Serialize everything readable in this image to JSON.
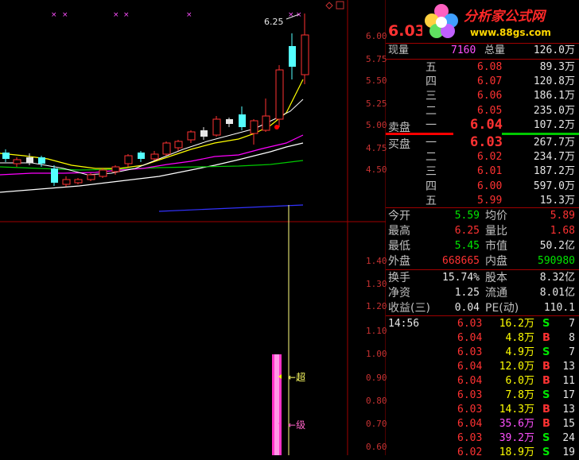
{
  "chart": {
    "price_axis": [
      "6.00",
      "5.75",
      "5.50",
      "5.25",
      "5.00",
      "4.75",
      "4.50"
    ],
    "indicator_axis": [
      "1.40",
      "1.30",
      "1.20",
      "1.10",
      "1.00",
      "0.90",
      "0.80",
      "0.70",
      "0.60"
    ],
    "high_marker": "6.25",
    "annot_chao": "超",
    "annot_ji": "级"
  },
  "quote": {
    "last_price": "6.03",
    "logo_title": "分析家公式网",
    "logo_url": "www.88gs.com",
    "now_vol_label": "现量",
    "now_vol": "7160",
    "total_vol_label": "总量",
    "total_vol": "126.0万",
    "sell_label": "卖盘",
    "buy_label": "买盘",
    "asks": [
      {
        "level": "五",
        "price": "6.08",
        "vol": "89.3万"
      },
      {
        "level": "四",
        "price": "6.07",
        "vol": "120.8万"
      },
      {
        "level": "三",
        "price": "6.06",
        "vol": "186.1万"
      },
      {
        "level": "二",
        "price": "6.05",
        "vol": "235.0万"
      },
      {
        "level": "一",
        "price": "6.04",
        "vol": "107.2万"
      }
    ],
    "bids": [
      {
        "level": "一",
        "price": "6.03",
        "vol": "267.7万"
      },
      {
        "level": "二",
        "price": "6.02",
        "vol": "234.7万"
      },
      {
        "level": "三",
        "price": "6.01",
        "vol": "187.2万"
      },
      {
        "level": "四",
        "price": "6.00",
        "vol": "597.0万"
      },
      {
        "level": "五",
        "price": "5.99",
        "vol": "15.3万"
      }
    ],
    "stats": {
      "open_label": "今开",
      "open": "5.59",
      "avg_label": "均价",
      "avg": "5.89",
      "high_label": "最高",
      "high": "6.25",
      "ratio_label": "量比",
      "ratio": "1.68",
      "low_label": "最低",
      "low": "5.45",
      "mcap_label": "市值",
      "mcap": "50.2亿",
      "outer_label": "外盘",
      "outer": "668665",
      "inner_label": "内盘",
      "inner": "590980",
      "turnover_label": "换手",
      "turnover": "15.74%",
      "capital_label": "股本",
      "capital": "8.32亿",
      "nav_label": "净资",
      "nav": "1.25",
      "float_label": "流通",
      "float": "8.01亿",
      "eps_label": "收益(三)",
      "eps": "0.04",
      "pe_label": "PE(动)",
      "pe": "110.1"
    },
    "ticks": [
      {
        "time": "14:56",
        "price": "6.03",
        "vol": "16.2万",
        "side": "S",
        "n": "7"
      },
      {
        "time": "",
        "price": "6.04",
        "vol": "4.8万",
        "side": "B",
        "n": "8"
      },
      {
        "time": "",
        "price": "6.03",
        "vol": "4.9万",
        "side": "S",
        "n": "7"
      },
      {
        "time": "",
        "price": "6.04",
        "vol": "12.0万",
        "side": "B",
        "n": "13"
      },
      {
        "time": "",
        "price": "6.04",
        "vol": "6.0万",
        "side": "B",
        "n": "11"
      },
      {
        "time": "",
        "price": "6.03",
        "vol": "7.8万",
        "side": "S",
        "n": "17"
      },
      {
        "time": "",
        "price": "6.03",
        "vol": "14.3万",
        "side": "B",
        "n": "13"
      },
      {
        "time": "",
        "price": "6.04",
        "vol": "35.6万",
        "side": "B",
        "n": "15"
      },
      {
        "time": "",
        "price": "6.03",
        "vol": "39.2万",
        "side": "S",
        "n": "24"
      },
      {
        "time": "",
        "price": "6.02",
        "vol": "18.9万",
        "side": "S",
        "n": "19"
      }
    ]
  }
}
